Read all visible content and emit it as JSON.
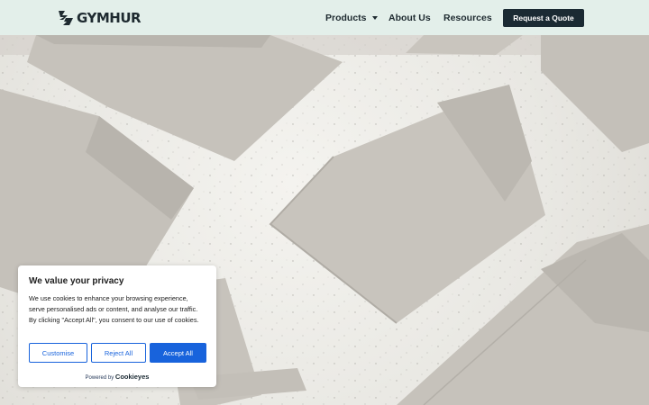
{
  "header": {
    "brand": "GYMHUR",
    "nav": {
      "products": "Products",
      "about": "About Us",
      "resources": "Resources"
    },
    "cta": "Request a Quote"
  },
  "hero": {
    "image": "flat-lay of beige athletic shorts on speckled white stone"
  },
  "cookie": {
    "title": "We value your privacy",
    "text": "We use cookies to enhance your browsing experience, serve personalised ads or content, and analyse our traffic. By clicking \"Accept All\", you consent to our use of cookies.",
    "customise": "Customise",
    "reject": "Reject All",
    "accept": "Accept All",
    "powered_by": "Powered by",
    "powered_brand": "Cookieyes",
    "accent_color": "#1863dc"
  },
  "colors": {
    "header_bg": "#e3efea",
    "dark": "#1b2a33"
  }
}
